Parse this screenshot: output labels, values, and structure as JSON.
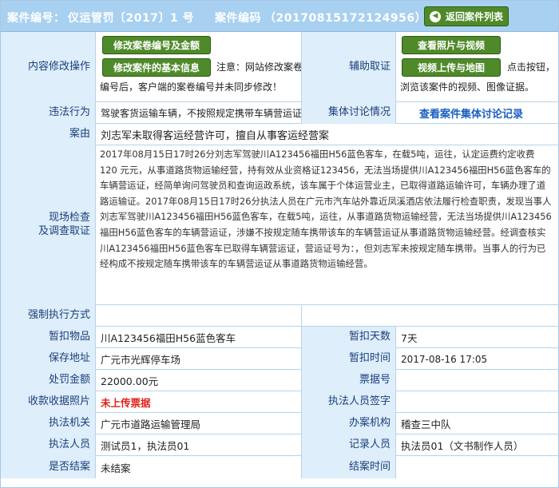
{
  "header": {
    "case_no_label": "案件编号：",
    "case_no_value": "仪运管罚〔2017〕1 号",
    "case_code_label": "案件编码",
    "case_code_value": "（20170815172124956）",
    "back_button": "返回案件列表"
  },
  "modify": {
    "label": "内容修改操作",
    "btn_edit_no": "修改案卷编号及金额",
    "btn_edit_info": "修改案件的基本信息",
    "note_line1": "注意：网站修改案卷",
    "note_line2": "编号后，客户端的案卷编号并未同步修改！"
  },
  "evidence": {
    "label": "辅助取证",
    "btn_view_photos": "查看照片与视频",
    "btn_upload": "视频上传与地图",
    "note_line1": "点击按钮，",
    "note_line2": "浏览该案件的视频、图像证据。"
  },
  "violation": {
    "label": "违法行为",
    "value": "驾驶客货运输车辆，不按照规定携带车辆营运证"
  },
  "discussion": {
    "label": "集体讨论情况",
    "link": "查看案件集体讨论记录"
  },
  "cause": {
    "label": "案由",
    "value": "刘志军未取得客运经营许可，擅自从事客运经营案"
  },
  "inspection": {
    "label_line1": "现场检查",
    "label_line2": "及调查取证",
    "text": "2017年08月15日17时26分刘志军驾驶川A123456福田H56蓝色客车，在载5吨，运往，认定运费约定收费 120 元元，从事道路货物运输经营，持有效从业资格证123456，无法当场提供川A123456福田H56蓝色客车的车辆营运证，经简单询问驾驶员和查询运政系统，该车属于个体运营业主，已取得道路运输许可，车辆办理了道路运输证。2017年08月15日17时26分执法人员在广元市汽车站外靠近凤溪酒店依法履行检查职责，发现当事人刘志军驾驶川A123456福田H56蓝色客车，在载5吨，运往，从事道路货物运输经营，无法当场提供川A123456福田H56蓝色客车的车辆营运证，涉嫌不按规定随车携带该车的车辆营运证从事道路货物运输经营。经调查核实川A123456福田H56蓝色客车已取得车辆营运证，营运证号为：，但刘志军未按规定随车携带。当事人的行为已经构成不按规定随车携带该车的车辆营运证从事道路货物运输经营。"
  },
  "enforce": {
    "label": "强制执行方式",
    "value": ""
  },
  "seized_item": {
    "label": "暂扣物品",
    "value": "川A123456福田H56蓝色客车"
  },
  "seized_days": {
    "label": "暂扣天数",
    "value": "7天"
  },
  "storage": {
    "label": "保存地址",
    "value": "广元市光辉停车场"
  },
  "seized_time": {
    "label": "暂扣时间",
    "value": "2017-08-16 17:05"
  },
  "fine": {
    "label": "处罚金额",
    "value": "22000.00元"
  },
  "ticket_no": {
    "label": "票据号",
    "value": ""
  },
  "receipt_photo": {
    "label": "收款收据照片",
    "value": "未上传票据"
  },
  "officer_sign": {
    "label": "执法人员签字",
    "value": ""
  },
  "agency": {
    "label": "执法机关",
    "value": "广元市道路运输管理局"
  },
  "handling_org": {
    "label": "办案机构",
    "value": "稽查三中队"
  },
  "officers": {
    "label": "执法人员",
    "value": "测试员1，执法员01"
  },
  "recorder": {
    "label": "记录人员",
    "value": "执法员01（文书制作人员）"
  },
  "closed": {
    "label": "是否结案",
    "value": "未结案"
  },
  "close_time": {
    "label": "结案时间",
    "value": ""
  },
  "colors": {
    "header_bg": "#a8d0f0",
    "label_bg": "#deeefb",
    "button_green": "#4f8a2a",
    "link_blue": "#1b5fc2",
    "alert_red": "#e0201b"
  }
}
